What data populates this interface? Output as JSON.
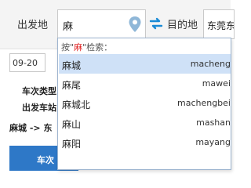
{
  "search": {
    "from_label": "出发地",
    "from_value": "麻",
    "to_label": "目的地",
    "to_value": "东莞东"
  },
  "date": {
    "value": "09-20"
  },
  "filters": {
    "row1": "车次类型",
    "row2": "出发车站"
  },
  "route_text": "麻城 -> 东",
  "table": {
    "header_label": "车次"
  },
  "dropdown": {
    "hint_prefix": "按\"",
    "hint_key": "麻",
    "hint_suffix": "\"检索：",
    "items": [
      {
        "name": "麻城",
        "pinyin": "macheng",
        "selected": true
      },
      {
        "name": "麻尾",
        "pinyin": "mawei",
        "selected": false
      },
      {
        "name": "麻城北",
        "pinyin": "machengbei",
        "selected": false
      },
      {
        "name": "麻山",
        "pinyin": "mashan",
        "selected": false
      },
      {
        "name": "麻阳",
        "pinyin": "mayang",
        "selected": false
      }
    ]
  },
  "colors": {
    "accent": "#2e78c7",
    "swap_icon": "#1a8bd6",
    "pin_icon": "#8fb7d8",
    "hint_key": "#e02020",
    "selected_row": "#cfe1f7"
  },
  "icons": {
    "pin": "location-pin-icon",
    "swap": "swap-arrows-icon"
  }
}
